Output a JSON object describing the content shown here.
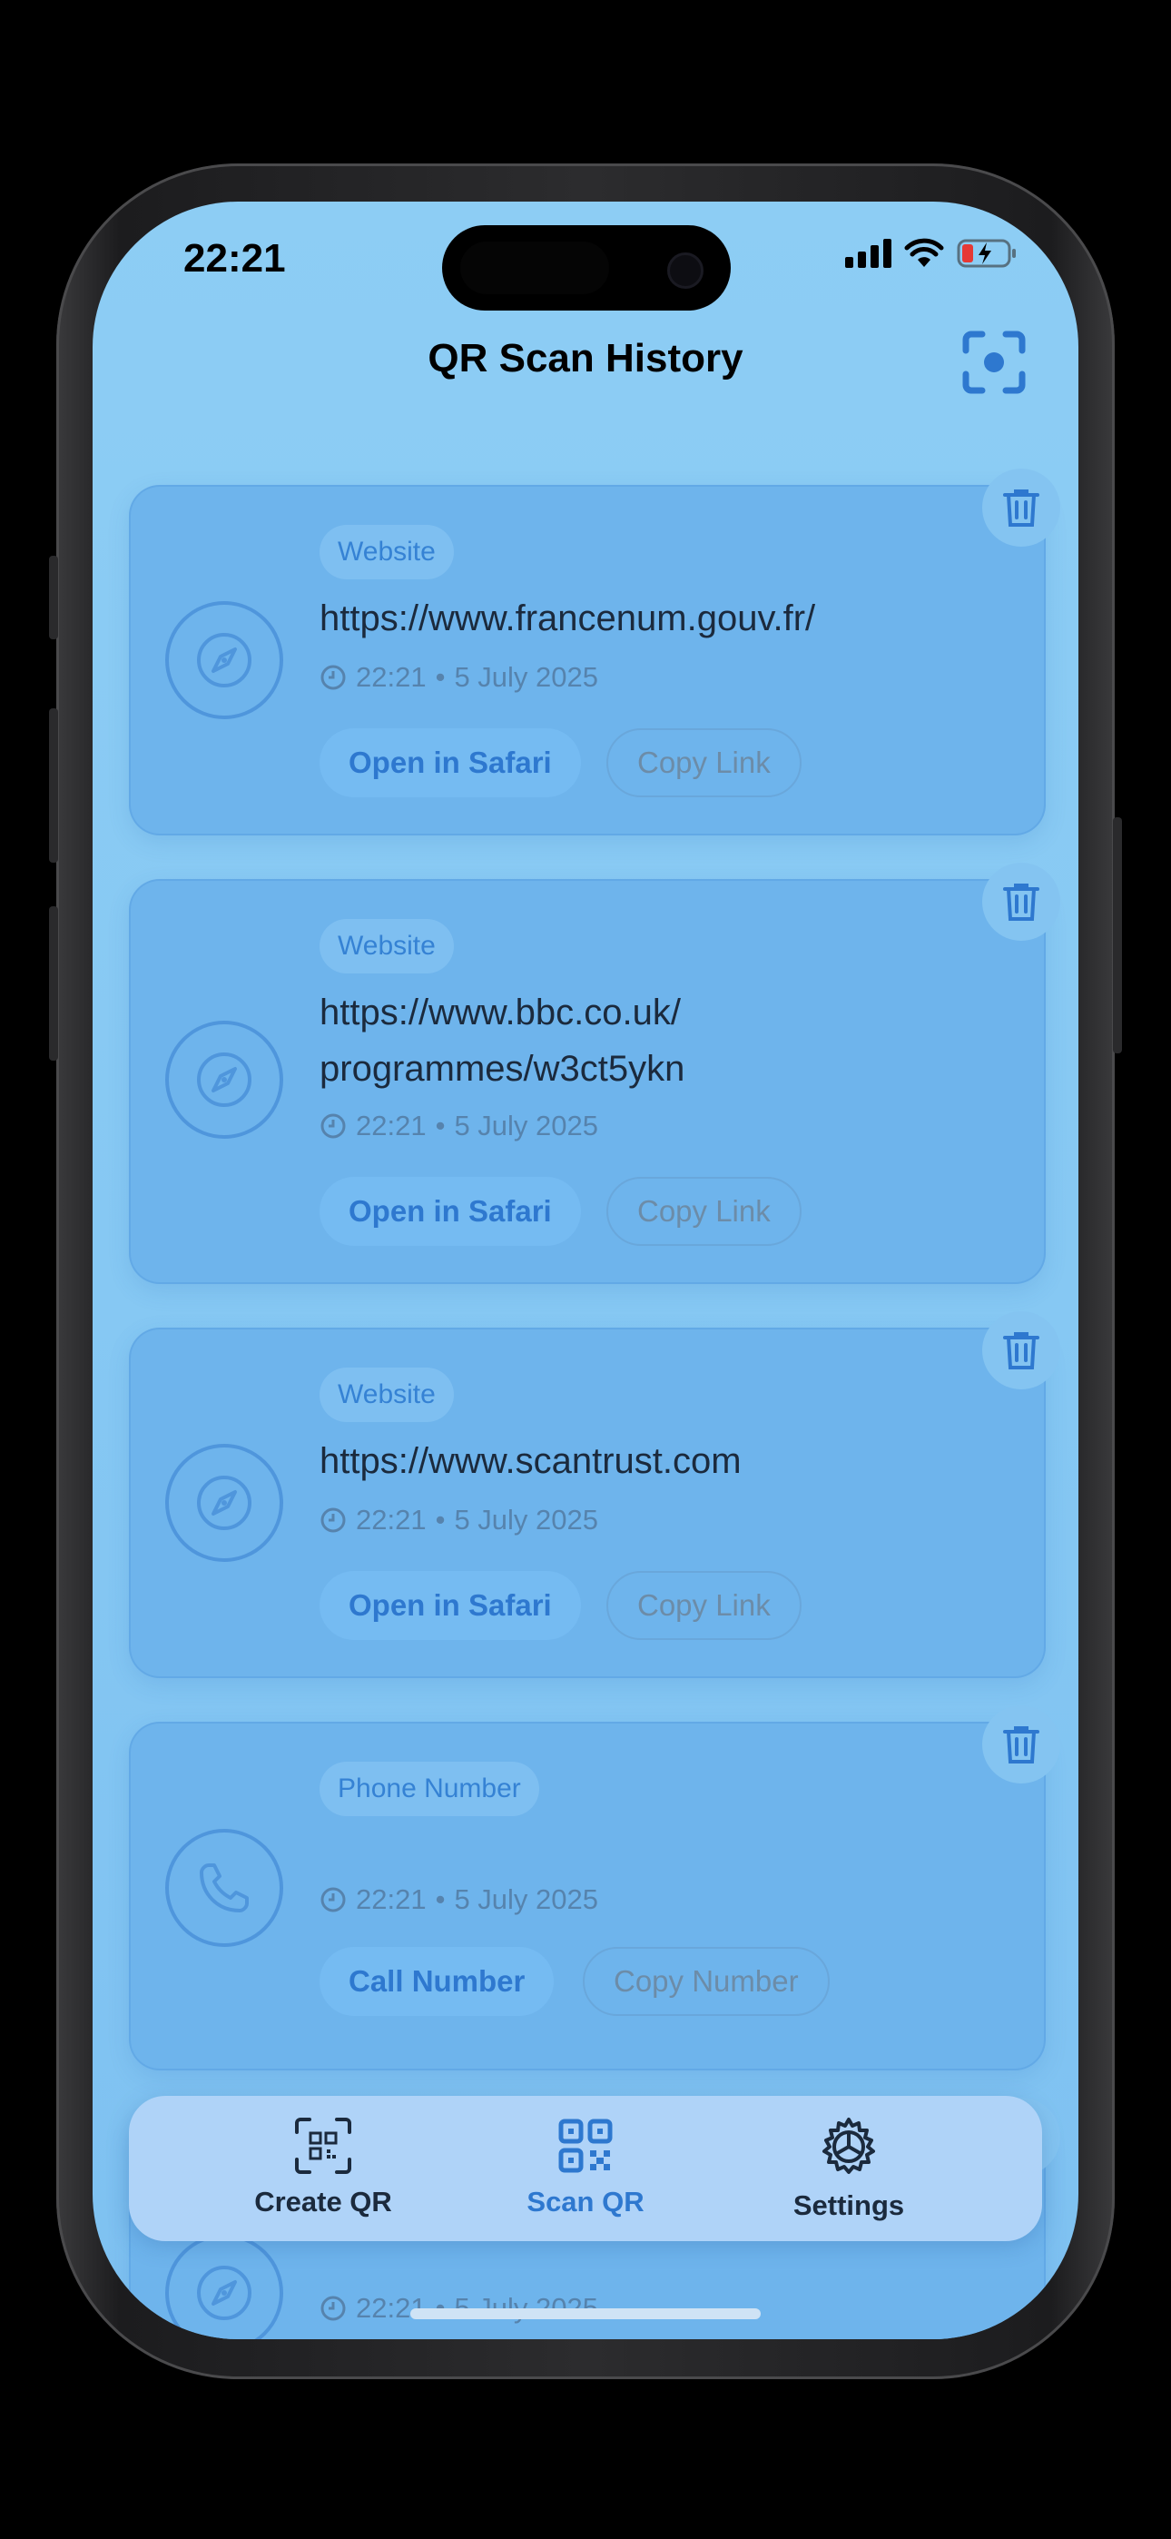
{
  "status_bar": {
    "time": "22:21"
  },
  "header": {
    "title": "QR Scan History",
    "scan_icon": "viewfinder-icon"
  },
  "colors": {
    "background": "#8dcdf4",
    "card": "#6eb4ec",
    "accent": "#2e78cf",
    "tabbar": "#afd3f8"
  },
  "history": [
    {
      "type": "Website",
      "content": [
        "https://www.francenum.gouv.fr/"
      ],
      "icon": "compass-icon",
      "time": "22:21",
      "date": "5 July 2025",
      "primary_action": "Open in Safari",
      "secondary_action": "Copy Link"
    },
    {
      "type": "Website",
      "content": [
        "https://www.bbc.co.uk/",
        "programmes/w3ct5ykn"
      ],
      "icon": "compass-icon",
      "time": "22:21",
      "date": "5 July 2025",
      "primary_action": "Open in Safari",
      "secondary_action": "Copy Link"
    },
    {
      "type": "Website",
      "content": [
        "https://www.scantrust.com"
      ],
      "icon": "compass-icon",
      "time": "22:21",
      "date": "5 July 2025",
      "primary_action": "Open in Safari",
      "secondary_action": "Copy Link"
    },
    {
      "type": "Phone Number",
      "content": [],
      "icon": "phone-icon",
      "time": "22:21",
      "date": "5 July 2025",
      "primary_action": "Call Number",
      "secondary_action": "Copy Number"
    },
    {
      "icon": "compass-icon",
      "time": "22:21",
      "date": "5 July 2025"
    }
  ],
  "separator": "•",
  "tabs": [
    {
      "label": "Create QR",
      "icon": "qr-create-icon",
      "active": false
    },
    {
      "label": "Scan QR",
      "icon": "qr-scan-icon",
      "active": true
    },
    {
      "label": "Settings",
      "icon": "gear-icon",
      "active": false
    }
  ]
}
